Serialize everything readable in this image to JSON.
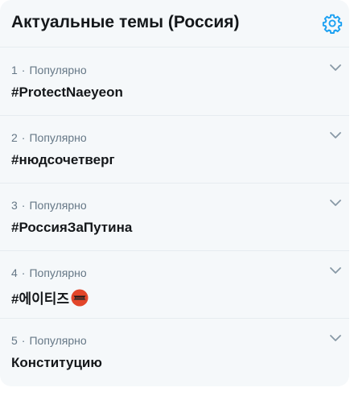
{
  "header": {
    "title": "Актуальные темы (Россия)",
    "settings_icon": "gear-icon",
    "accent_color": "#1da1f2"
  },
  "trends": [
    {
      "rank": "1",
      "separator": "·",
      "context": "Популярно",
      "name": "#ProtectNaeyeon"
    },
    {
      "rank": "2",
      "separator": "·",
      "context": "Популярно",
      "name": "#нюдсочетверг"
    },
    {
      "rank": "3",
      "separator": "·",
      "context": "Популярно",
      "name": "#РоссияЗаПутина"
    },
    {
      "rank": "4",
      "separator": "·",
      "context": "Популярно",
      "name": "#에이티즈",
      "emoji": "ateez-hashflag-icon"
    },
    {
      "rank": "5",
      "separator": "·",
      "context": "Популярно",
      "name": "Конституцию"
    }
  ],
  "trend_menu_icon": "chevron-down-icon"
}
